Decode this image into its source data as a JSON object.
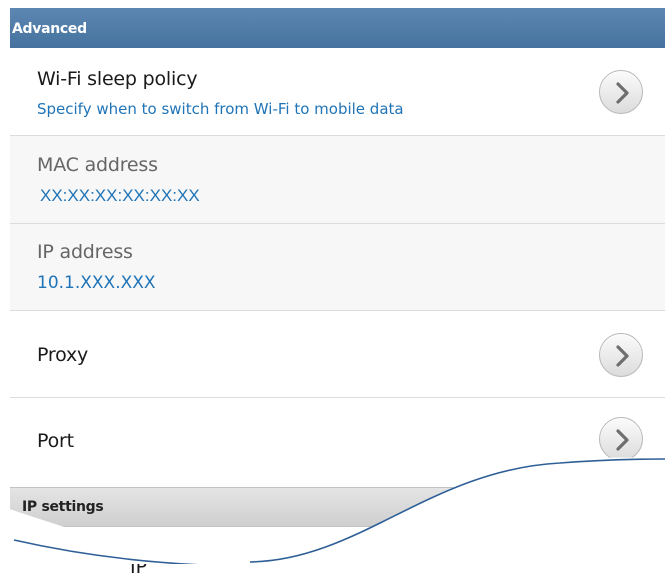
{
  "section_header": {
    "title": "Advanced"
  },
  "rows": [
    {
      "title": "Wi-Fi sleep policy",
      "subtitle": "Specify when to switch from Wi-Fi to mobile data",
      "chevron": "chevron-right-icon"
    },
    {
      "title": "MAC address",
      "value": "XX:XX:XX:XX:XX:XX"
    },
    {
      "title": "IP address",
      "value": "10.1.XXX.XXX"
    },
    {
      "title": "Proxy",
      "chevron": "chevron-right-icon"
    },
    {
      "title": "Port",
      "chevron": "chevron-right-icon"
    }
  ],
  "sub_header": {
    "title": "IP settings"
  },
  "tail": {
    "partial_label": "IP"
  },
  "colors": {
    "header_bg": "#4f7ca9",
    "value_text": "#1f74b8",
    "tear_line": "#2f5f97"
  }
}
